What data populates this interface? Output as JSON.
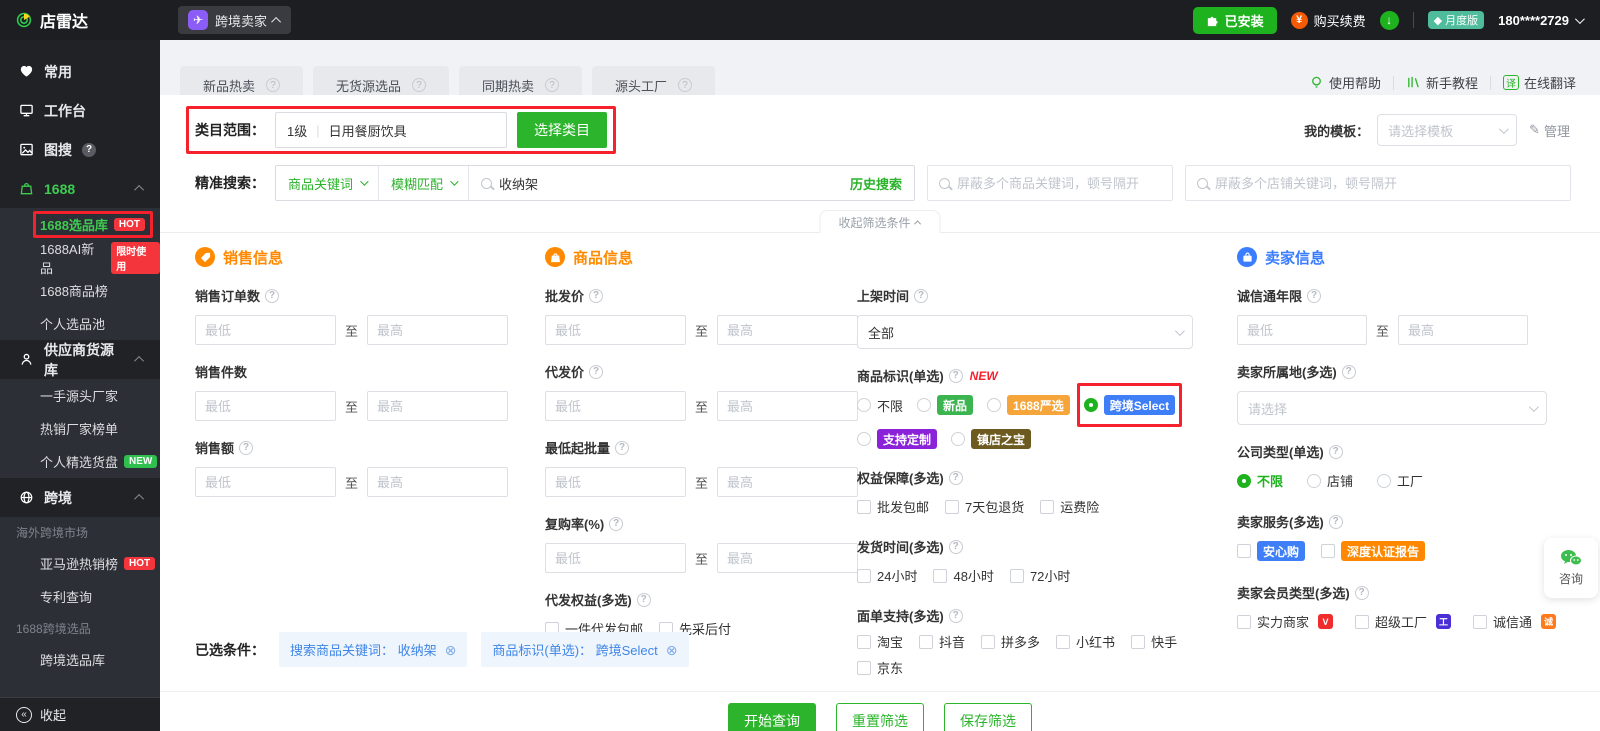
{
  "colors": {
    "primary_green": "#2cb52c",
    "topbar_bg": "#1d1e22",
    "sidebar_bg": "#2d2f36",
    "annotation_red": "#f5212d",
    "section_orange": "#ff8a00",
    "section_blue": "#3a7dff",
    "badge_new_product": "#3cb550",
    "badge_1688_yanxuan": "#f5a53a",
    "badge_kuajing_select": "#3e7ef7",
    "badge_custom": "#8a22d8",
    "badge_zhendian": "#6d5a20",
    "badge_anxin": "#3e7ef7",
    "badge_deep_cert": "#ff8800",
    "hot_badge": "#f5353c",
    "plan_badge": "#4fbd9b"
  },
  "topbar": {
    "logo_text": "店雷达",
    "persona_button": "跨境卖家",
    "installed_button": "已安装",
    "renew_button": "购买续费",
    "plan_badge": "月度版",
    "account_phone": "180****2729"
  },
  "sidebar": {
    "items": [
      {
        "label": "常用"
      },
      {
        "label": "工作台"
      },
      {
        "label": "图搜"
      },
      {
        "label": "1688"
      },
      {
        "label": "1688选品库",
        "badge": "HOT"
      },
      {
        "label": "1688AI新品",
        "badge": "限时使用"
      },
      {
        "label": "1688商品榜"
      },
      {
        "label": "个人选品池"
      },
      {
        "label": "供应商货源库"
      },
      {
        "label": "一手源头厂家"
      },
      {
        "label": "热销厂家榜单"
      },
      {
        "label": "个人精选货盘",
        "badge": "NEW"
      },
      {
        "label": "跨境"
      },
      {
        "label": "海外跨境市场"
      },
      {
        "label": "亚马逊热销榜",
        "badge": "HOT"
      },
      {
        "label": "专利查询"
      },
      {
        "label": "1688跨境选品"
      },
      {
        "label": "跨境选品库"
      }
    ],
    "collapse": "收起"
  },
  "main": {
    "tabs": [
      {
        "label": "新品热卖"
      },
      {
        "label": "无货源选品"
      },
      {
        "label": "同期热卖"
      },
      {
        "label": "源头工厂"
      }
    ],
    "help_links": [
      {
        "label": "使用帮助"
      },
      {
        "label": "新手教程"
      },
      {
        "label": "在线翻译"
      }
    ],
    "category_row": {
      "label": "类目范围：",
      "level": "1级",
      "value": "日用餐厨饮具",
      "button": "选择类目"
    },
    "template_row": {
      "label": "我的模板：",
      "placeholder": "请选择模板",
      "manage": "管理"
    },
    "search_row": {
      "label": "精准搜索：",
      "keyword_type": "商品关键词",
      "match_mode": "模糊匹配",
      "keyword_value": "收纳架",
      "history": "历史搜索",
      "block_product_placeholder": "屏蔽多个商品关键词，顿号隔开",
      "block_shop_placeholder": "屏蔽多个店铺关键词，顿号隔开"
    },
    "collapse_filters": "收起筛选条件",
    "common": {
      "min": "最低",
      "to": "至",
      "max": "最高"
    },
    "sections": {
      "sales": {
        "title": "销售信息",
        "fields": [
          {
            "label": "销售订单数"
          },
          {
            "label": "销售件数"
          },
          {
            "label": "销售额"
          }
        ]
      },
      "product": {
        "title": "商品信息",
        "fields": [
          {
            "label": "批发价"
          },
          {
            "label": "代发价"
          },
          {
            "label": "最低起批量"
          },
          {
            "label": "复购率(%)"
          }
        ],
        "dropship": {
          "label": "代发权益(多选)",
          "options": [
            "一件代发包邮",
            "先采后付"
          ]
        }
      },
      "listing": {
        "shelf_time": {
          "label": "上架时间",
          "value": "全部"
        },
        "product_tags": {
          "label": "商品标识(单选)",
          "new_flag": "NEW",
          "options": [
            "不限",
            "新品",
            "1688严选",
            "跨境Select",
            "支持定制",
            "镇店之宝"
          ],
          "selected": "跨境Select"
        },
        "guarantees": {
          "label": "权益保障(多选)",
          "options": [
            "批发包邮",
            "7天包退货",
            "运费险"
          ]
        },
        "ship_time": {
          "label": "发货时间(多选)",
          "options": [
            "24小时",
            "48小时",
            "72小时"
          ]
        },
        "waybill": {
          "label": "面单支持(多选)",
          "options": [
            "淘宝",
            "抖音",
            "拼多多",
            "小红书",
            "快手",
            "京东"
          ]
        }
      },
      "seller": {
        "title": "卖家信息",
        "years": {
          "label": "诚信通年限"
        },
        "location": {
          "label": "卖家所属地(多选)",
          "placeholder": "请选择"
        },
        "company_type": {
          "label": "公司类型(单选)",
          "options": [
            "不限",
            "店铺",
            "工厂"
          ],
          "selected": "不限"
        },
        "services": {
          "label": "卖家服务(多选)",
          "options": [
            "安心购",
            "深度认证报告"
          ]
        },
        "member_type": {
          "label": "卖家会员类型(多选)",
          "options": [
            "实力商家",
            "超级工厂",
            "诚信通"
          ]
        }
      }
    },
    "selected": {
      "label": "已选条件：",
      "tags": [
        "搜索商品关键词： 收纳架",
        "商品标识(单选)： 跨境Select"
      ]
    },
    "actions": {
      "query": "开始查询",
      "reset": "重置筛选",
      "save": "保存筛选"
    },
    "consult": "咨询"
  }
}
